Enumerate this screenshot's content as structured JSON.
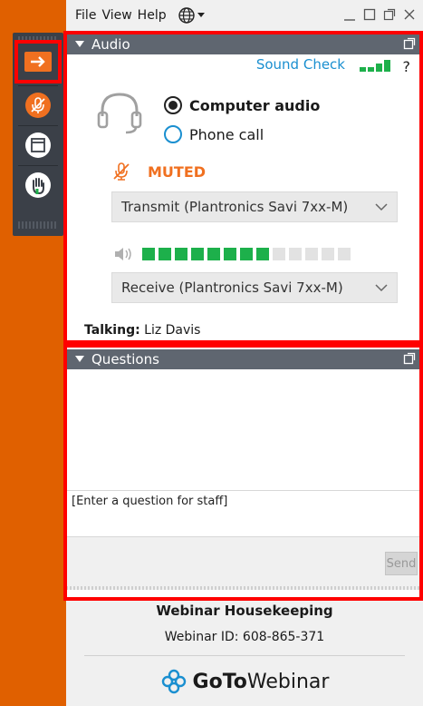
{
  "menubar": {
    "items": [
      "File",
      "View",
      "Help"
    ],
    "icons": [
      "globe-icon",
      "chevron-down-icon"
    ],
    "window_controls": [
      "minimize-icon",
      "restore-icon",
      "popout-icon",
      "close-icon"
    ]
  },
  "grabtab": {
    "buttons": [
      "collapse-arrow-icon",
      "microphone-muted-icon",
      "screen-icon",
      "raise-hand-icon"
    ]
  },
  "audio": {
    "header": "Audio",
    "sound_check": "Sound Check",
    "help": "?",
    "options": {
      "computer": "Computer audio",
      "phone": "Phone call"
    },
    "selected": "computer",
    "mute_status": "MUTED",
    "transmit_device": "Transmit (Plantronics Savi 7xx-M)",
    "receive_device": "Receive (Plantronics Savi 7xx-M)",
    "level_active": 8,
    "level_total": 13,
    "talking_label": "Talking:",
    "talking_name": "Liz Davis"
  },
  "questions": {
    "header": "Questions",
    "input_value": "[Enter a question for staff]",
    "send_label": "Send"
  },
  "footer": {
    "title": "Webinar Housekeeping",
    "webinar_id": "Webinar ID: 608-865-371",
    "logo_goto": "GoTo",
    "logo_webinar": "Webinar"
  },
  "colors": {
    "background": "#e06000",
    "accent_orange": "#f07020",
    "header_gray": "#5f6670",
    "link_blue": "#1a8fd0",
    "level_green": "#1db04b",
    "highlight_red": "#ff0000"
  }
}
